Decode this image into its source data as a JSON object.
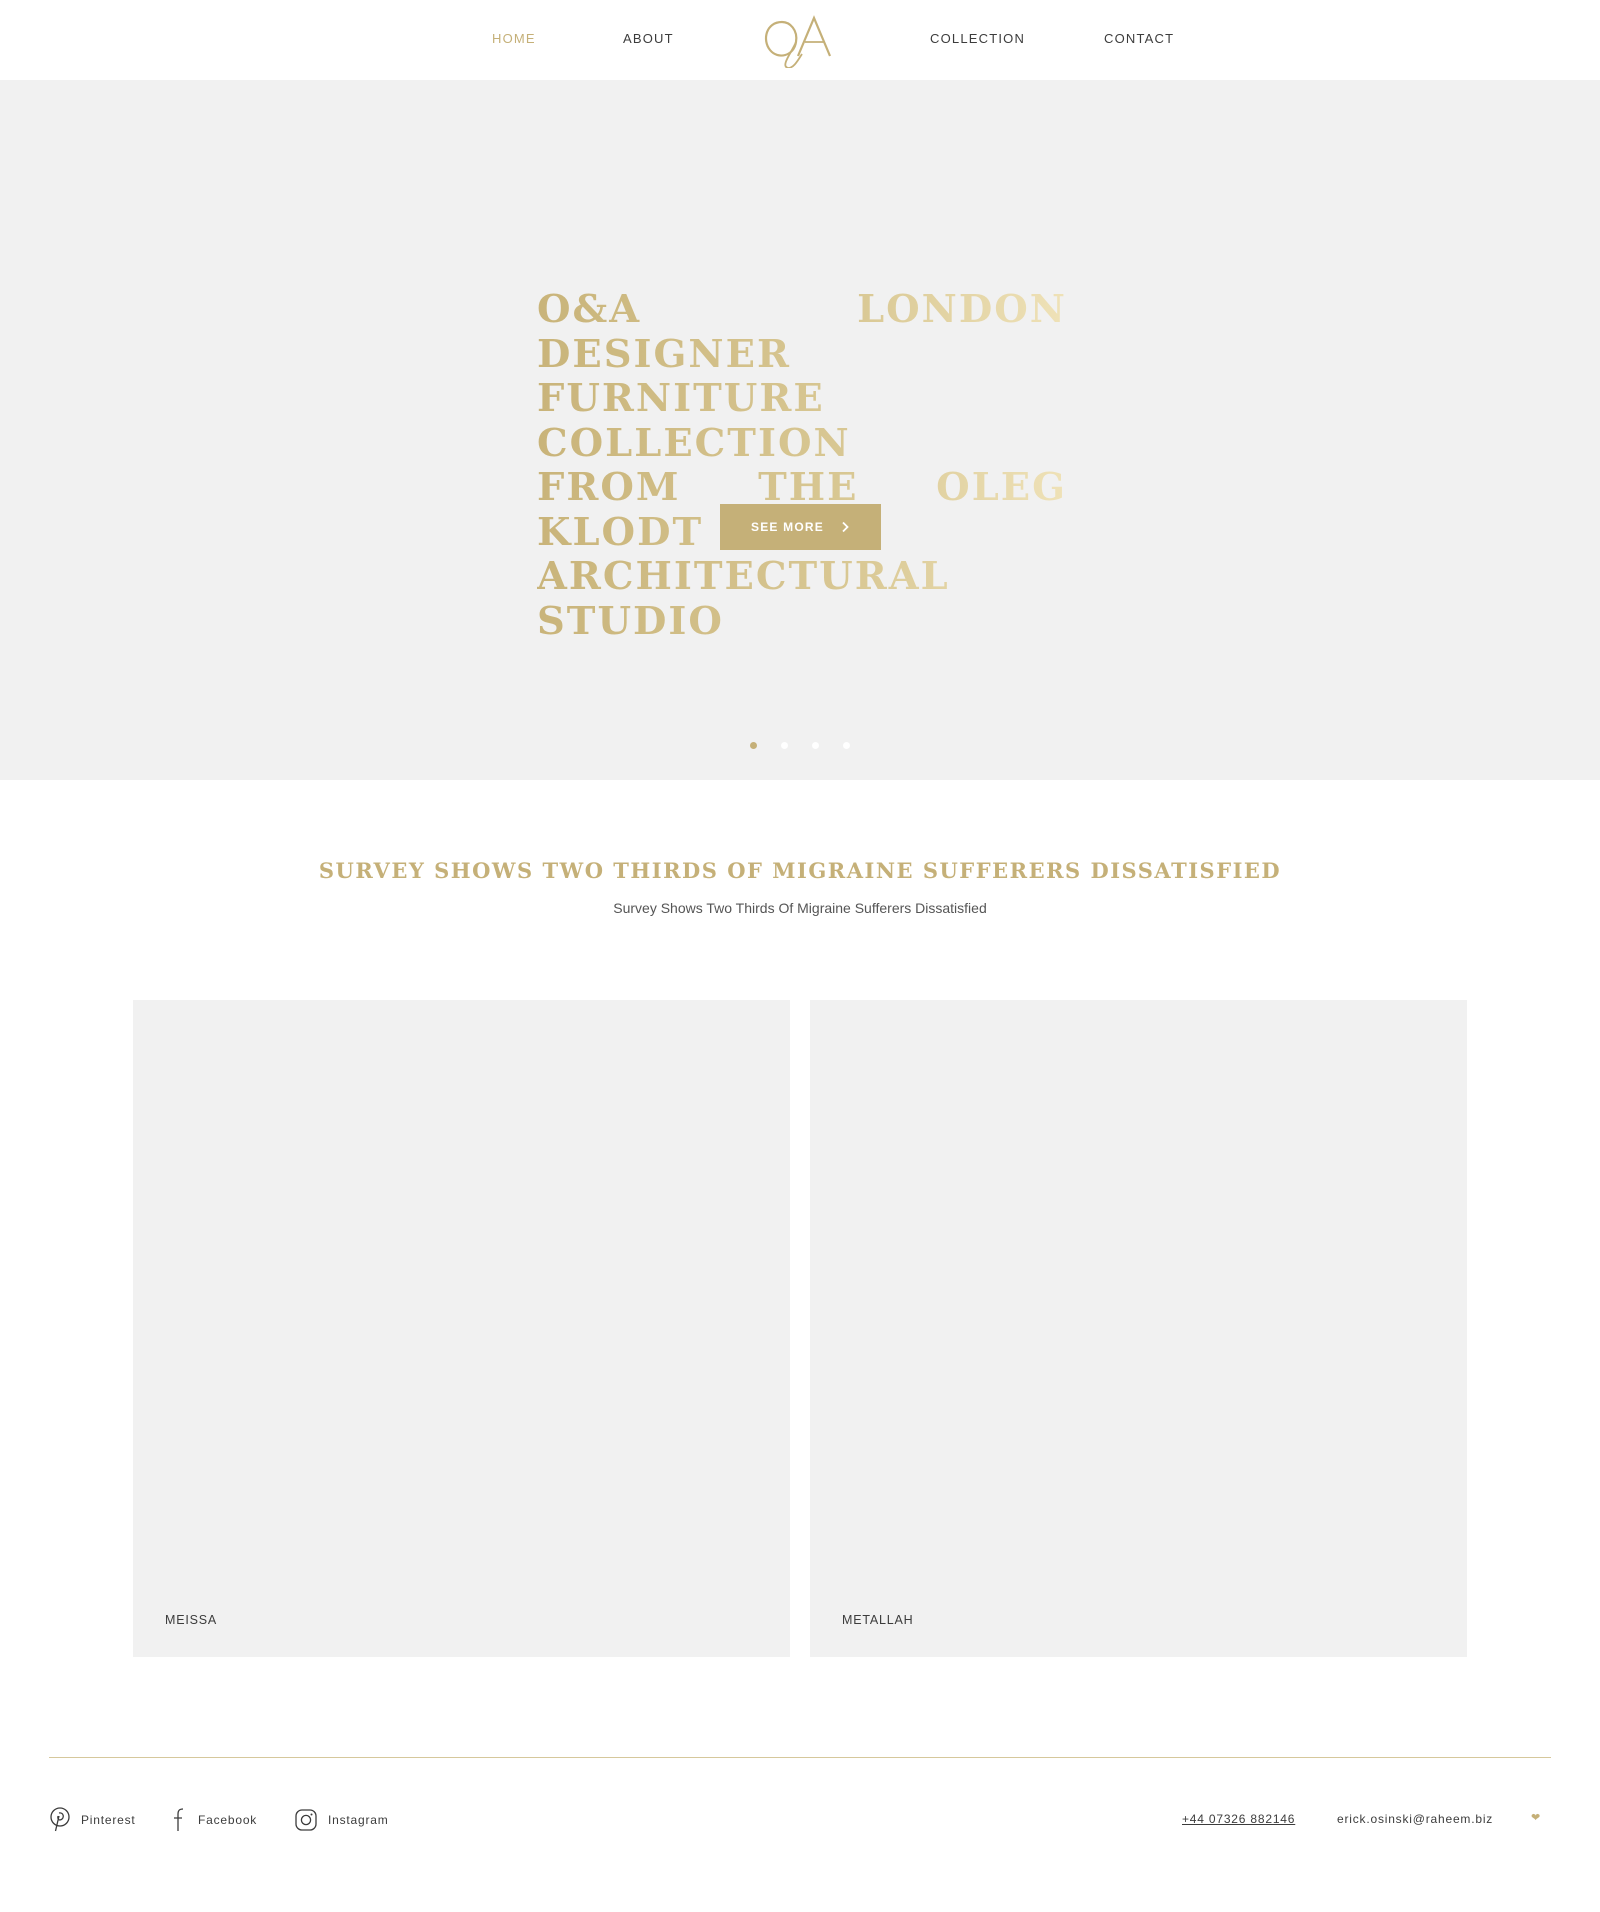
{
  "nav": {
    "home": "HOME",
    "about": "ABOUT",
    "collection": "COLLECTION",
    "contact": "CONTACT",
    "logo_text": "O&A"
  },
  "hero": {
    "title_lines": [
      "O&A LONDON DESIGNER",
      "FURNITURE COLLECTION",
      "FROM THE OLEG KLODT",
      "ARCHITECTURAL STUDIO"
    ],
    "button_label": "SEE MORE",
    "slides_total": 4,
    "active_slide": 1
  },
  "section": {
    "title": "SURVEY SHOWS TWO THIRDS OF MIGRAINE SUFFERERS DISSATISFIED",
    "subtitle": "Survey Shows Two Thirds Of Migraine Sufferers Dissatisfied"
  },
  "cards": [
    {
      "label": "MEISSA"
    },
    {
      "label": "METALLAH"
    }
  ],
  "footer": {
    "social": [
      {
        "label": "Pinterest",
        "icon": "pinterest-icon"
      },
      {
        "label": "Facebook",
        "icon": "facebook-icon"
      },
      {
        "label": "Instagram",
        "icon": "instagram-icon"
      }
    ],
    "phone": "+44 07326 882146",
    "email": "erick.osinski@raheem.biz",
    "heart_icon": "heart-icon"
  },
  "colors": {
    "accent": "#c5b078",
    "panel": "#f1f1f1",
    "text": "#3c3c3c"
  }
}
